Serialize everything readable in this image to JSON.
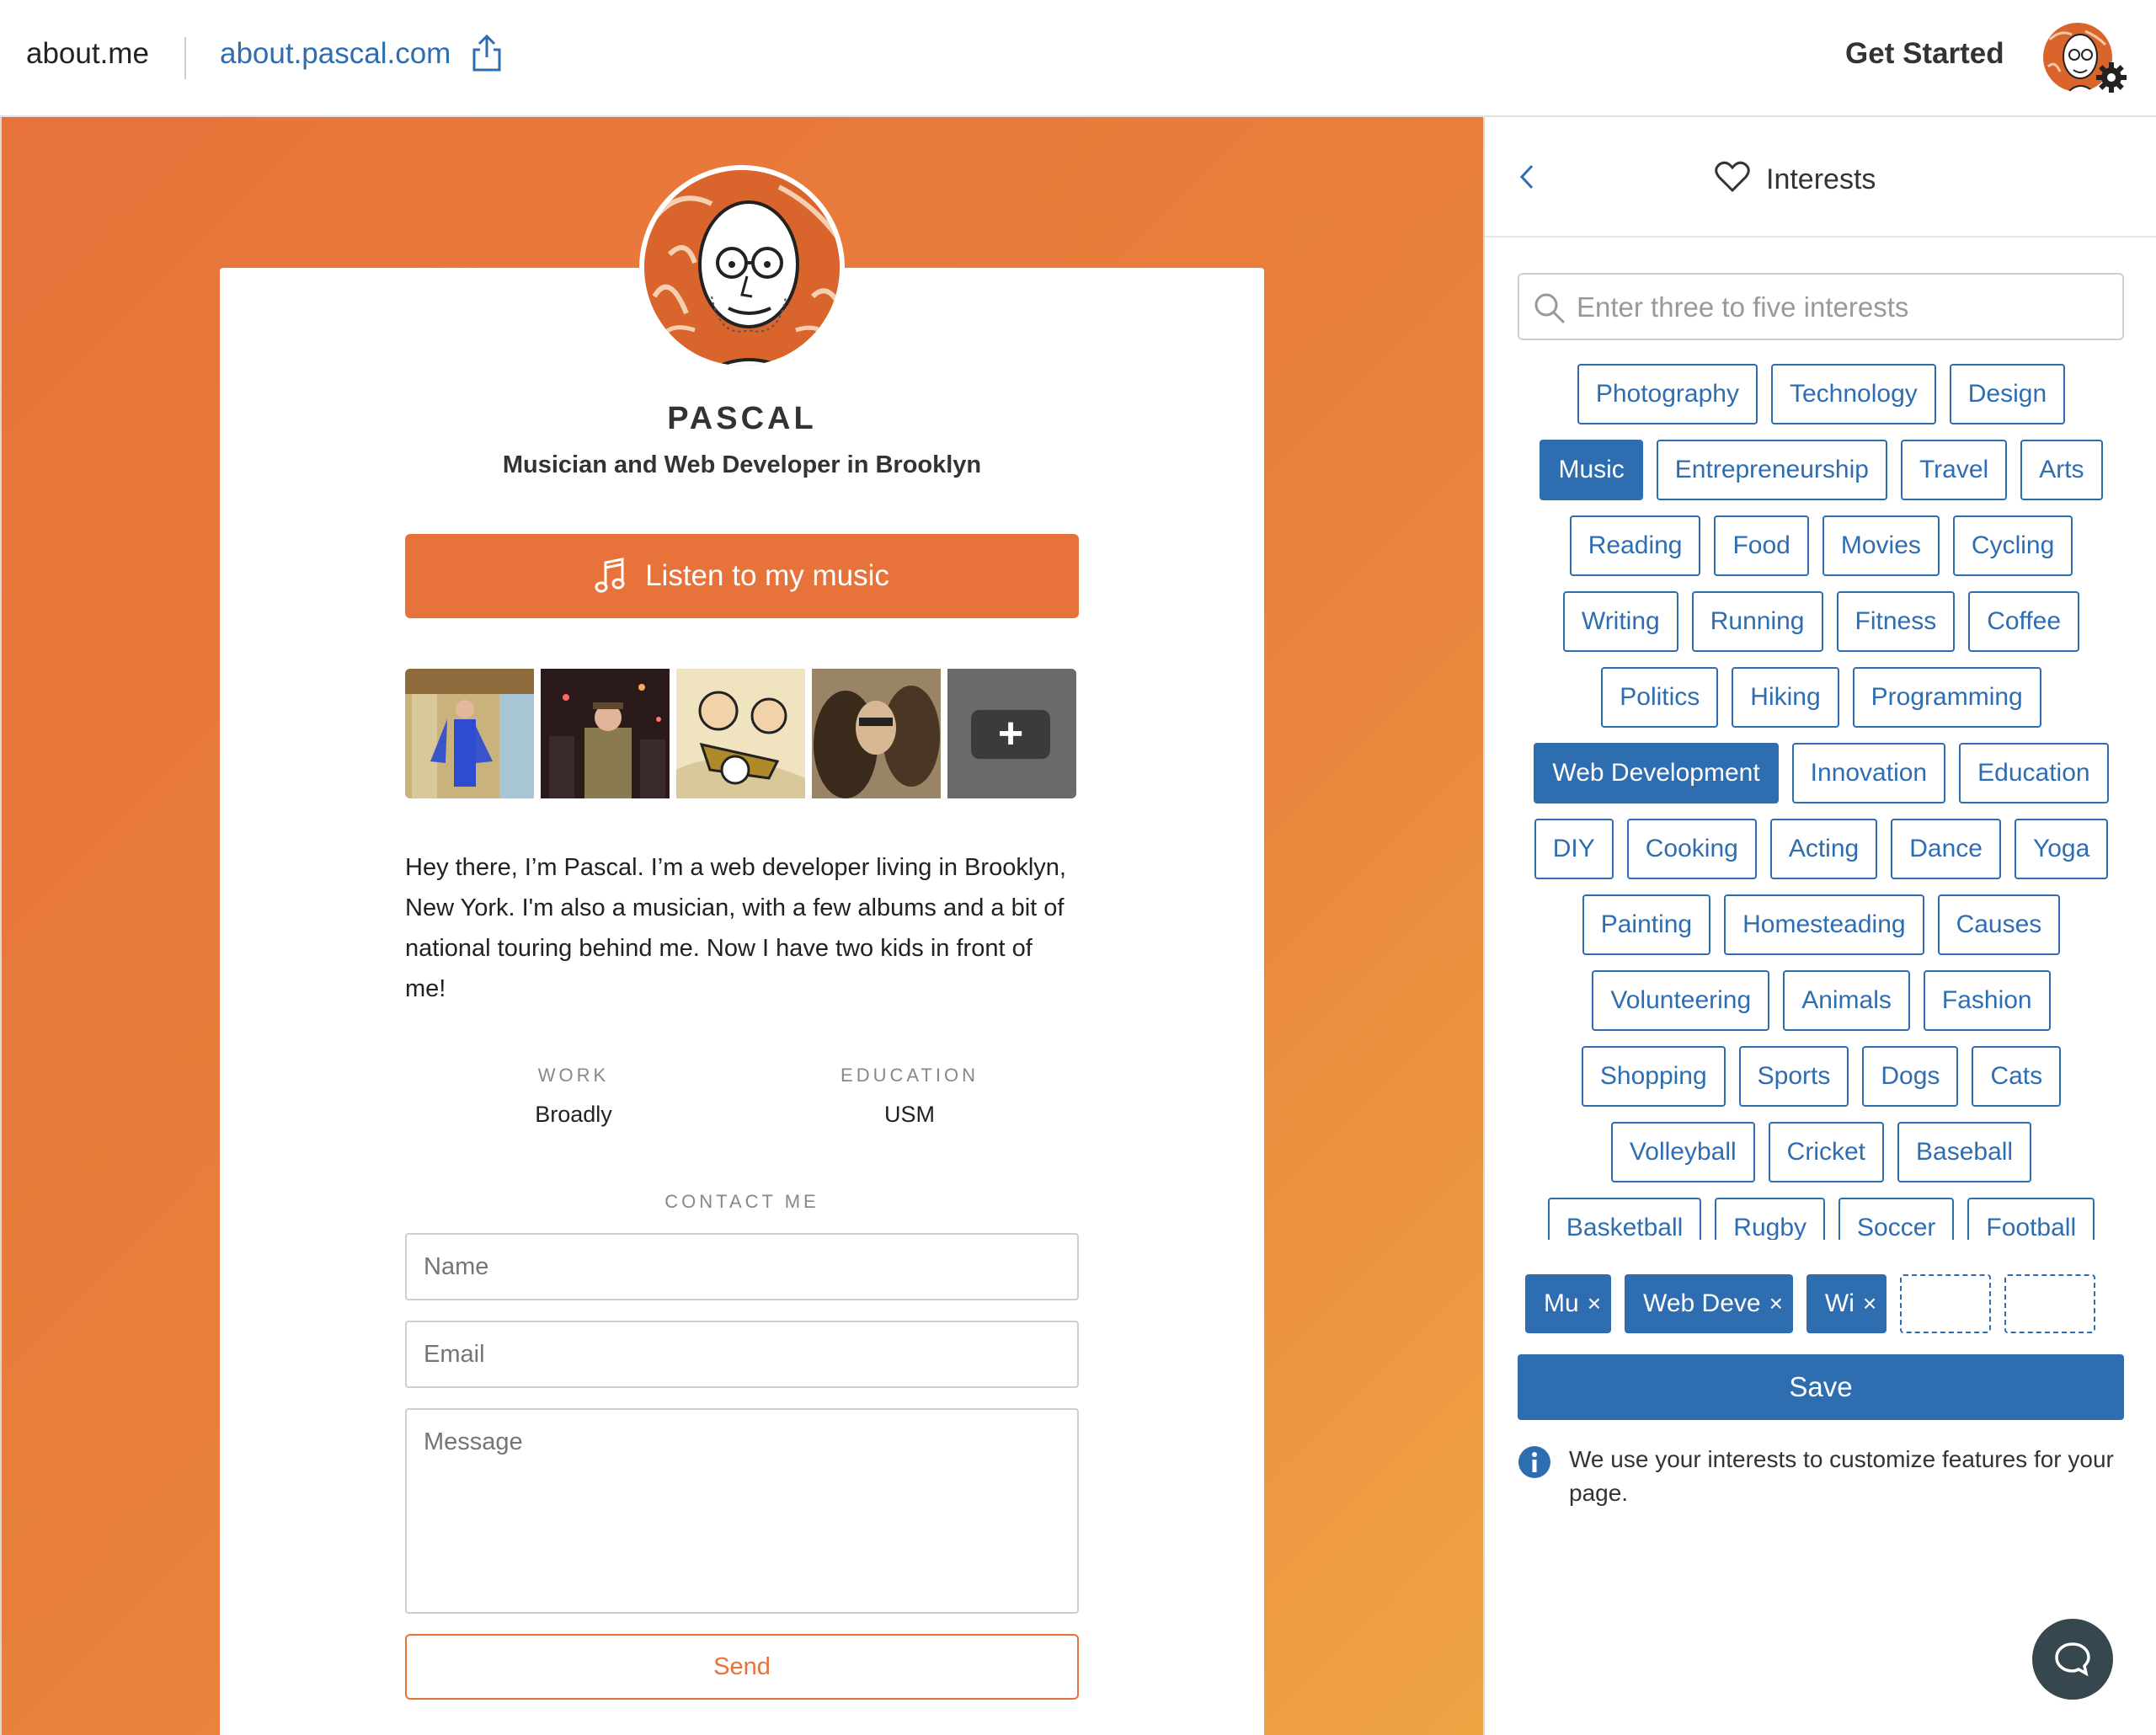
{
  "header": {
    "brand": "about.me",
    "site_link": "about.pascal.com",
    "get_started": "Get Started"
  },
  "profile": {
    "name": "PASCAL",
    "headline": "Musician and Web Developer in Brooklyn",
    "cta_label": "Listen to my music",
    "bio": "Hey there, I’m Pascal. I’m a web developer living in Brooklyn, New York. I'm also a musician, with a few albums and a bit of national touring behind me. Now I have two kids in front of me!",
    "work_label": "WORK",
    "work_value": "Broadly",
    "education_label": "EDUCATION",
    "education_value": "USM",
    "contact_label": "CONTACT ME",
    "name_placeholder": "Name",
    "email_placeholder": "Email",
    "message_placeholder": "Message",
    "send_label": "Send"
  },
  "panel": {
    "title": "Interests",
    "search_placeholder": "Enter three to five interests",
    "tag_rows": [
      [
        "Photography",
        "Technology",
        "Design"
      ],
      [
        "Music",
        "Entrepreneurship",
        "Travel",
        "Arts"
      ],
      [
        "Reading",
        "Food",
        "Movies",
        "Cycling"
      ],
      [
        "Writing",
        "Running",
        "Fitness",
        "Coffee"
      ],
      [
        "Politics",
        "Hiking",
        "Programming"
      ],
      [
        "Web Development",
        "Innovation",
        "Education"
      ],
      [
        "DIY",
        "Cooking",
        "Acting",
        "Dance",
        "Yoga"
      ],
      [
        "Painting",
        "Homesteading",
        "Causes"
      ],
      [
        "Volunteering",
        "Animals",
        "Fashion"
      ],
      [
        "Shopping",
        "Sports",
        "Dogs",
        "Cats"
      ],
      [
        "Volleyball",
        "Cricket",
        "Baseball"
      ],
      [
        "Basketball",
        "Rugby",
        "Soccer",
        "Football"
      ]
    ],
    "selected_tags": [
      "Music",
      "Web Development"
    ],
    "chips": [
      {
        "label": "Mu",
        "remove": "×"
      },
      {
        "label": "Web Deve",
        "remove": "×"
      },
      {
        "label": "Wi",
        "remove": "×"
      }
    ],
    "empty_slots": 2,
    "save_label": "Save",
    "info_text": "We use your interests to customize features for your page."
  },
  "colors": {
    "accent_orange": "#e7733a",
    "accent_blue": "#2f6db1",
    "chat_bubble": "#37474f"
  },
  "icons": [
    "share-icon",
    "gear-icon",
    "music-note-icon",
    "back-icon",
    "heart-icon",
    "search-icon",
    "info-icon",
    "chat-icon"
  ]
}
